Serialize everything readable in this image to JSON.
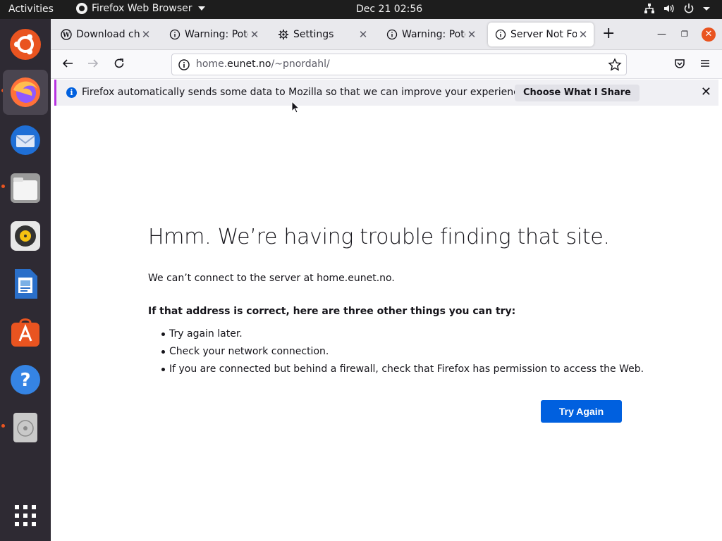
{
  "topbar": {
    "activities": "Activities",
    "app_name": "Firefox Web Browser",
    "clock": "Dec 21  02:56"
  },
  "dock": {
    "items": [
      {
        "name": "ubuntu-software-logo",
        "running": false
      },
      {
        "name": "firefox",
        "running": true,
        "active": true
      },
      {
        "name": "thunderbird",
        "running": false
      },
      {
        "name": "files",
        "running": true
      },
      {
        "name": "rhythmbox",
        "running": false
      },
      {
        "name": "libreoffice-writer",
        "running": false
      },
      {
        "name": "ubuntu-software",
        "running": false
      },
      {
        "name": "help",
        "running": false
      },
      {
        "name": "optical-drive",
        "running": true
      }
    ],
    "show_apps": "show-applications-grid"
  },
  "tabs": [
    {
      "title": "Download chn",
      "icon": "wordpress-icon",
      "selected": false
    },
    {
      "title": "Warning: Poter",
      "icon": "info-icon",
      "selected": false
    },
    {
      "title": "Settings",
      "icon": "gear-icon",
      "selected": false
    },
    {
      "title": "Warning: Poter",
      "icon": "info-icon",
      "selected": false
    },
    {
      "title": "Server Not Fou",
      "icon": "info-icon",
      "selected": true
    }
  ],
  "urlbar": {
    "prefix": "home.",
    "host": "eunet.no",
    "path": "/~pnordahl/"
  },
  "notification": {
    "message": "Firefox automatically sends some data to Mozilla so that we can improve your experience.",
    "button": "Choose What I Share"
  },
  "error_page": {
    "title": "Hmm. We’re having trouble finding that site.",
    "description": "We can’t connect to the server at home.eunet.no.",
    "lead": "If that address is correct, here are three other things you can try:",
    "suggestions": [
      "Try again later.",
      "Check your network connection.",
      "If you are connected but behind a firewall, check that Firefox has permission to access the Web."
    ],
    "button": "Try Again"
  },
  "colors": {
    "accent": "#0060df",
    "ubuntu_orange": "#e95420",
    "dock_bg": "#2e2a33",
    "topbar_bg": "#1d1d1d"
  }
}
